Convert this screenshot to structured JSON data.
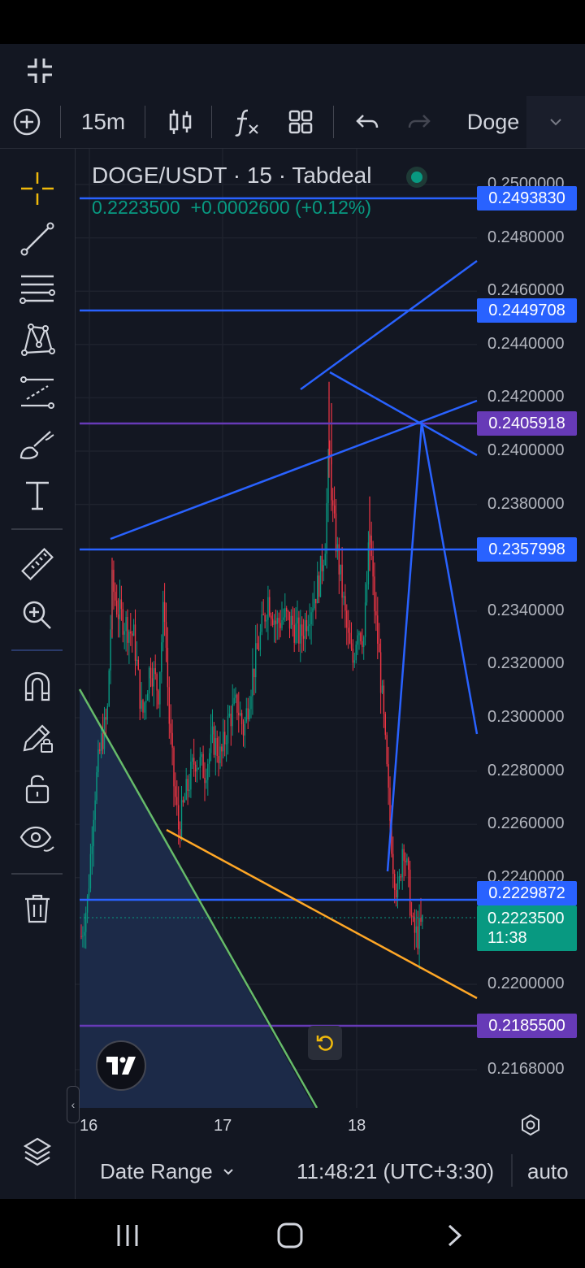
{
  "toolbar": {
    "interval": "15m",
    "symbol": "Doge"
  },
  "legend": {
    "title": "DOGE/USDT · 15 · Tabdeal",
    "price": "0.2223500",
    "change": "+0.0002600 (+0.12%)"
  },
  "price_axis": {
    "labels": [
      "0.2500000",
      "0.2480000",
      "0.2460000",
      "0.2440000",
      "0.2420000",
      "0.2400000",
      "0.2380000",
      "0.2340000",
      "0.2320000",
      "0.2300000",
      "0.2280000",
      "0.2260000",
      "0.2240000",
      "0.2200000",
      "0.2168000"
    ]
  },
  "price_tags": {
    "h1": "0.2493830",
    "h2": "0.2449708",
    "h3": "0.2405918",
    "h4": "0.2357998",
    "h5": "0.2229872",
    "h6": "0.2185500"
  },
  "current": {
    "price": "0.2223500",
    "countdown": "11:38"
  },
  "time_axis": {
    "labels": [
      "16",
      "17",
      "18"
    ]
  },
  "bottom": {
    "date_range": "Date Range",
    "clock": "11:48:21 (UTC+3:30)",
    "scale": "auto"
  },
  "colors": {
    "background": "#131722",
    "up": "#089981",
    "down": "#f23645",
    "line_blue": "#2962ff",
    "line_purple": "#673ab7",
    "line_green": "#66bb6a",
    "line_orange": "#ffa726"
  }
}
